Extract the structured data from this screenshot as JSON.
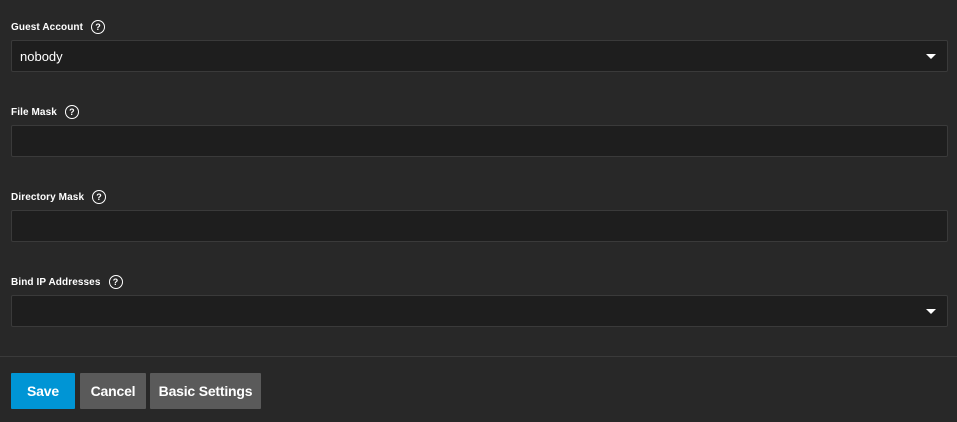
{
  "form": {
    "guest_account": {
      "label": "Guest Account",
      "value": "nobody",
      "help_icon": "question-circle-icon"
    },
    "file_mask": {
      "label": "File Mask",
      "value": "",
      "help_icon": "question-circle-icon"
    },
    "directory_mask": {
      "label": "Directory Mask",
      "value": "",
      "help_icon": "question-circle-icon"
    },
    "bind_ip": {
      "label": "Bind IP Addresses",
      "value": "",
      "help_icon": "question-circle-icon"
    }
  },
  "actions": {
    "save_label": "Save",
    "cancel_label": "Cancel",
    "basic_settings_label": "Basic Settings"
  },
  "colors": {
    "background": "#282828",
    "input_bg": "#1e1e1e",
    "primary": "#0095d5",
    "secondary": "#5a5a5a"
  }
}
